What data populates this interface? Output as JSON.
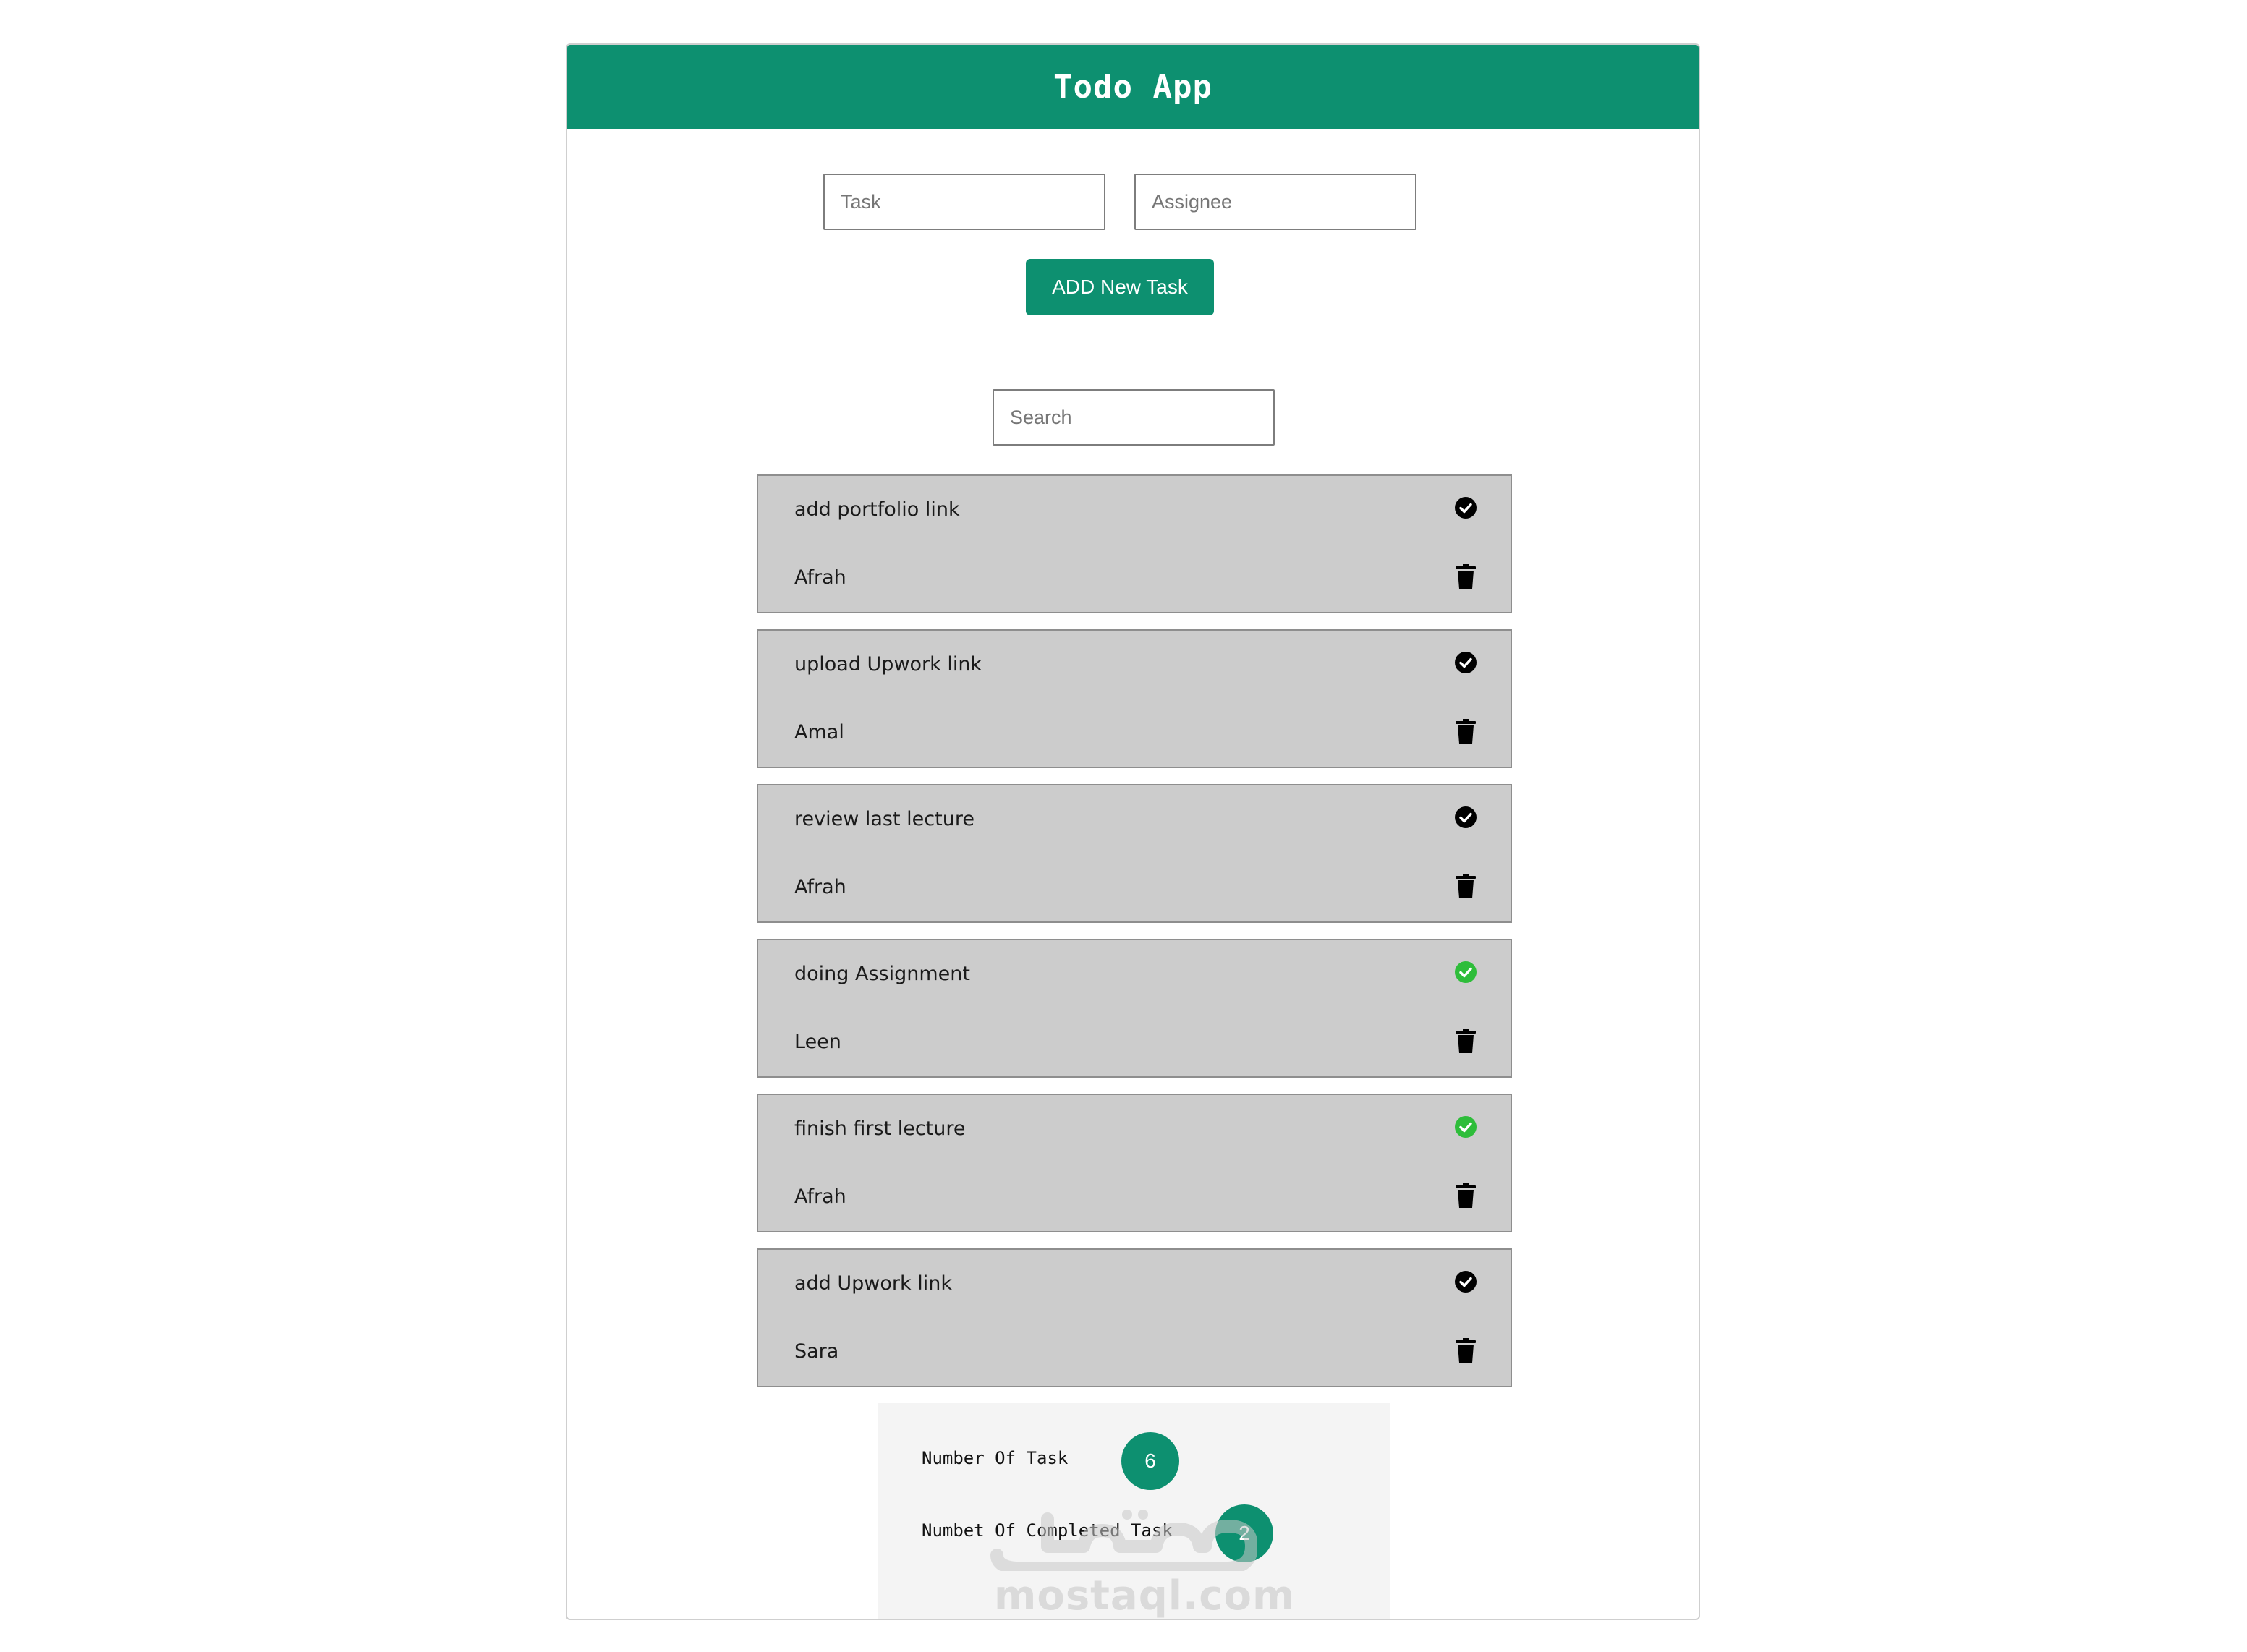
{
  "header": {
    "title": "Todo App"
  },
  "form": {
    "task_placeholder": "Task",
    "task_value": "",
    "assignee_placeholder": "Assignee",
    "assignee_value": "",
    "add_button_label": "ADD New Task"
  },
  "search": {
    "placeholder": "Search",
    "value": ""
  },
  "tasks": [
    {
      "name": "add portfolio link",
      "assignee": "Afrah",
      "completed": false
    },
    {
      "name": "upload Upwork link",
      "assignee": "Amal",
      "completed": false
    },
    {
      "name": "review last lecture",
      "assignee": "Afrah",
      "completed": false
    },
    {
      "name": "doing Assignment",
      "assignee": "Leen",
      "completed": true
    },
    {
      "name": "finish first lecture",
      "assignee": "Afrah",
      "completed": true
    },
    {
      "name": "add Upwork link",
      "assignee": "Sara",
      "completed": false
    }
  ],
  "icons": {
    "complete": "check-circle-icon",
    "delete": "trash-icon"
  },
  "stats": {
    "total_label": "Number Of Task",
    "total_value": "6",
    "completed_label": "Numbet Of Completed Task",
    "completed_value": "2"
  },
  "watermark": {
    "text": "mostaql.com"
  },
  "colors": {
    "accent": "#0d9070",
    "task_bg": "#cccccc",
    "completed_check": "#2ebd3a",
    "pending_check": "#000000"
  }
}
